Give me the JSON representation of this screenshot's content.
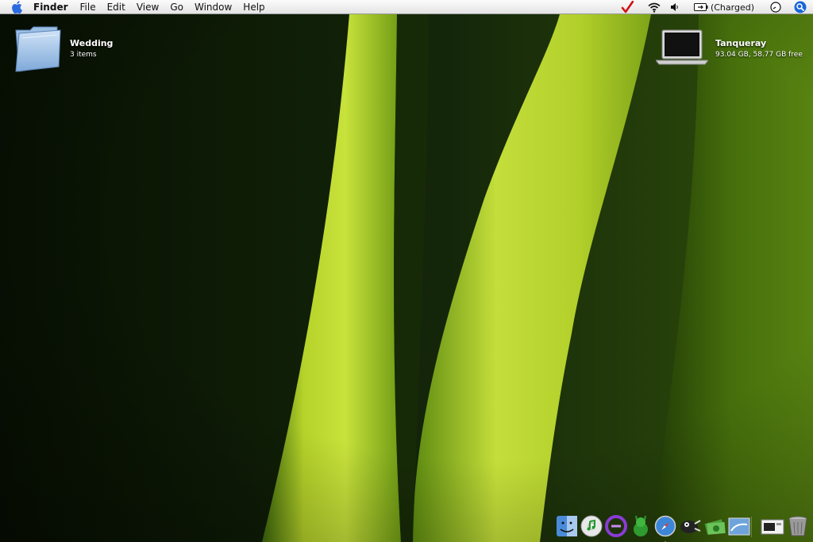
{
  "menubar": {
    "app_name": "Finder",
    "menus": [
      "File",
      "Edit",
      "View",
      "Go",
      "Window",
      "Help"
    ],
    "battery_status": "(Charged)",
    "icons": [
      "apple-icon",
      "checkmark-icon",
      "wifi-icon",
      "volume-icon",
      "battery-icon",
      "clock-icon",
      "spotlight-icon"
    ],
    "accent_color": "#1a66d9"
  },
  "desktop": {
    "items": [
      {
        "name": "Wedding",
        "info": "3 items",
        "icon": "folder-icon"
      },
      {
        "name": "Tanqueray",
        "info": "93.04 GB, 58.77 GB free",
        "icon": "laptop-drive-icon"
      }
    ]
  },
  "dock": {
    "apps": [
      "finder-icon",
      "itunes-icon",
      "dashboard-icon",
      "adium-icon",
      "safari-icon",
      "camino-icon",
      "money-icon",
      "mail-icon"
    ],
    "others": [
      "preview-window-icon",
      "trash-icon"
    ]
  }
}
